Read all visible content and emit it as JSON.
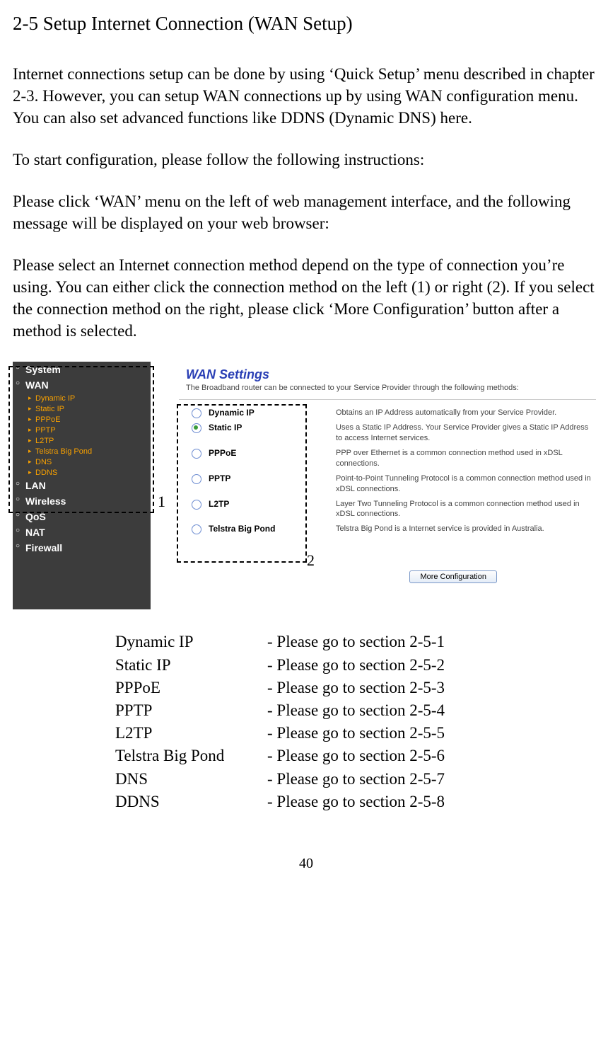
{
  "title": "2-5 Setup Internet Connection (WAN Setup)",
  "paragraphs": [
    "Internet connections setup can be done by using ‘Quick Setup’ menu described in chapter 2-3. However, you can setup WAN connections up by using WAN configuration menu. You can also set advanced functions like DDNS (Dynamic DNS) here.",
    "To start configuration, please follow the following instructions:",
    "Please click ‘WAN’ menu on the left of web management interface, and the following message will be displayed on your web browser:",
    "Please select an Internet connection method depend on the type of connection you’re using. You can either click the connection method on the left (1) or right (2). If you select the connection method on the right, please click ‘More Configuration’ button after a method is selected."
  ],
  "callouts": {
    "one": "1",
    "two": "2"
  },
  "sidebar": {
    "sections_top": [
      "System",
      "WAN"
    ],
    "subs": [
      "Dynamic IP",
      "Static IP",
      "PPPoE",
      "PPTP",
      "L2TP",
      "Telstra Big Pond",
      "DNS",
      "DDNS"
    ],
    "sections_bottom": [
      "LAN",
      "Wireless",
      "QoS",
      "NAT",
      "Firewall"
    ]
  },
  "wan": {
    "heading": "WAN Settings",
    "intro": "The Broadband router can be connected to your Service Provider through the following methods:",
    "options": [
      {
        "label": "Dynamic IP",
        "desc": "Obtains an IP Address automatically from your Service Provider.",
        "selected": false
      },
      {
        "label": "Static IP",
        "desc": "Uses a Static IP Address. Your Service Provider gives a Static IP Address to access Internet services.",
        "selected": true
      },
      {
        "label": "PPPoE",
        "desc": "PPP over Ethernet is a common connection method used in xDSL connections.",
        "selected": false
      },
      {
        "label": "PPTP",
        "desc": "Point-to-Point Tunneling Protocol is a common connection method used in xDSL connections.",
        "selected": false
      },
      {
        "label": "L2TP",
        "desc": "Layer Two Tunneling Protocol is a common connection method used in xDSL connections.",
        "selected": false
      },
      {
        "label": "Telstra Big Pond",
        "desc": "Telstra Big Pond is a Internet service is provided in Australia.",
        "selected": false
      }
    ],
    "more_btn": "More Configuration"
  },
  "sections": [
    {
      "key": "Dynamic IP",
      "val": "- Please go to section 2-5-1"
    },
    {
      "key": "Static IP",
      "val": "- Please go to section 2-5-2"
    },
    {
      "key": "PPPoE",
      "val": "- Please go to section 2-5-3"
    },
    {
      "key": "PPTP",
      "val": "- Please go to section 2-5-4"
    },
    {
      "key": "L2TP",
      "val": "- Please go to section 2-5-5"
    },
    {
      "key": "Telstra Big Pond",
      "val": "- Please go to section 2-5-6"
    },
    {
      "key": "DNS",
      "val": "- Please go to section 2-5-7"
    },
    {
      "key": "DDNS",
      "val": "- Please go to section 2-5-8"
    }
  ],
  "page_number": "40"
}
